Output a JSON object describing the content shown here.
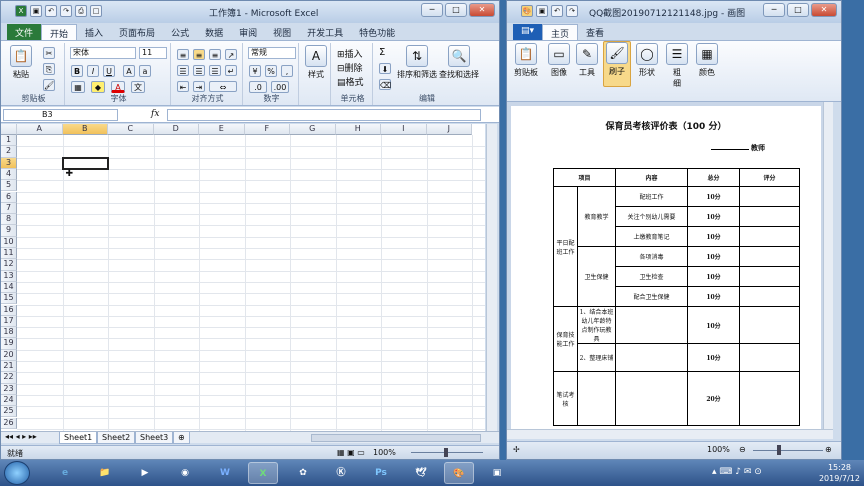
{
  "excel": {
    "title": "工作簿1 - Microsoft Excel",
    "qat_undo": "↶",
    "qat_redo": "↷",
    "tabs": [
      "开始",
      "插入",
      "页面布局",
      "公式",
      "数据",
      "审阅",
      "视图",
      "开发工具",
      "特色功能"
    ],
    "file_tab": "文件",
    "ribbon": {
      "paste": "粘贴",
      "clipboard": "剪贴板",
      "font_name": "宋体",
      "font_size": "11",
      "font_group": "字体",
      "bold": "B",
      "italic": "I",
      "underline": "U",
      "font_a": "A",
      "align_group": "对齐方式",
      "number_format": "常规",
      "number_group": "数字",
      "percent": "%",
      "comma": ",",
      "style": "样式",
      "insert": "插入",
      "delete": "删除",
      "format": "格式",
      "cells_group": "单元格",
      "sigma": "Σ",
      "sort": "排序和筛选",
      "find": "查找和选择",
      "edit_group": "编辑"
    },
    "name_box": "B3",
    "fx": "fx",
    "columns": [
      "A",
      "B",
      "C",
      "D",
      "E",
      "F",
      "G",
      "H",
      "I",
      "J"
    ],
    "rows": [
      "1",
      "2",
      "3",
      "4",
      "5",
      "6",
      "7",
      "8",
      "9",
      "10",
      "11",
      "12",
      "13",
      "14",
      "15",
      "16",
      "17",
      "18",
      "19",
      "20",
      "21",
      "22",
      "23",
      "24",
      "25",
      "26"
    ],
    "sheets": [
      "Sheet1",
      "Sheet2",
      "Sheet3"
    ],
    "status_ready": "就绪",
    "zoom": "100%"
  },
  "paint": {
    "title": "QQ截图20190712121148.jpg - 画图",
    "file_tab": "",
    "tabs": [
      "主页",
      "查看"
    ],
    "ribbon": {
      "clipboard": "剪贴板",
      "image": "图像",
      "tools": "工具",
      "brush": "刷子",
      "shapes": "形状",
      "size1": "粗",
      "size2": "细",
      "color": "颜色"
    },
    "zoom": "100%"
  },
  "document": {
    "title": "保育员考核评价表（100 分）",
    "teacher": "教师",
    "headers": [
      "项目",
      "内容",
      "总分",
      "评分"
    ],
    "cat1": "平日配班工作",
    "sub1": "教育教学",
    "sub2": "卫生保健",
    "cat2": "保育技能工作",
    "cat3": "笔试考核",
    "items": [
      "配班工作",
      "关注个别幼儿需要",
      "上缴教育笔记",
      "各项消毒",
      "卫生检查",
      "配合卫生保健"
    ],
    "skill1": "1、结合本班幼儿年龄特点制作玩教具",
    "skill2": "2、整理床铺",
    "scores": [
      "10分",
      "10分",
      "10分",
      "10分",
      "10分",
      "10分",
      "10分",
      "10分",
      "20分"
    ]
  },
  "taskbar": {
    "time": "15:28",
    "date": "2019/7/12",
    "ps": "Ps",
    "word": "W",
    "excel": "X"
  }
}
